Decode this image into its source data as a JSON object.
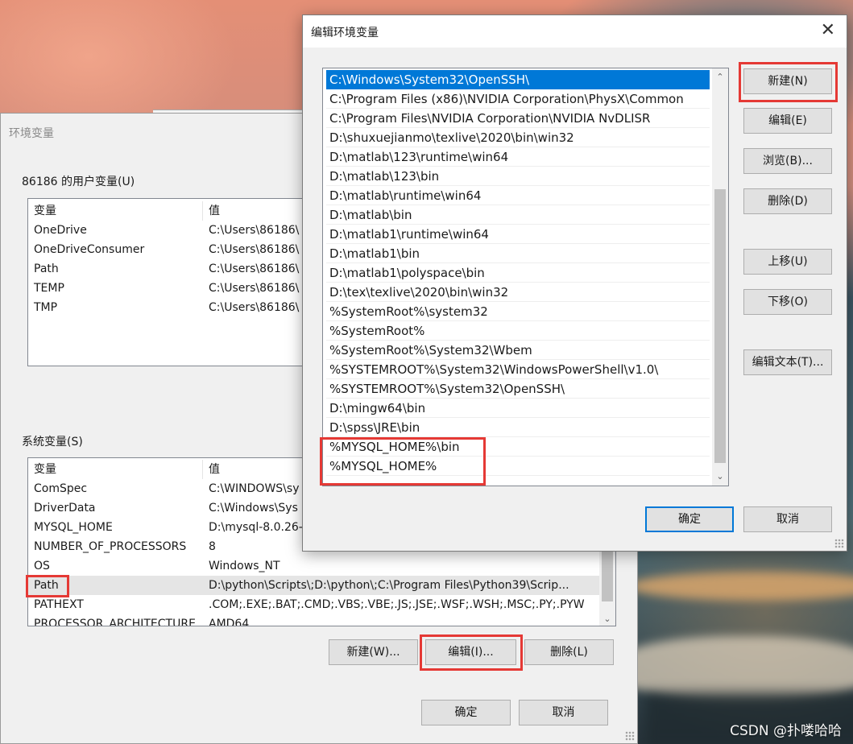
{
  "env_window": {
    "title": "环境变量",
    "user_vars": {
      "group_label": "86186 的用户变量(U)",
      "columns": [
        "变量",
        "值"
      ],
      "rows": [
        {
          "name": "OneDrive",
          "value": "C:\\Users\\86186\\"
        },
        {
          "name": "OneDriveConsumer",
          "value": "C:\\Users\\86186\\"
        },
        {
          "name": "Path",
          "value": "C:\\Users\\86186\\"
        },
        {
          "name": "TEMP",
          "value": "C:\\Users\\86186\\"
        },
        {
          "name": "TMP",
          "value": "C:\\Users\\86186\\"
        }
      ]
    },
    "system_vars": {
      "group_label": "系统变量(S)",
      "columns": [
        "变量",
        "值"
      ],
      "rows": [
        {
          "name": "ComSpec",
          "value": "C:\\WINDOWS\\sy"
        },
        {
          "name": "DriverData",
          "value": "C:\\Windows\\Sys"
        },
        {
          "name": "MYSQL_HOME",
          "value": "D:\\mysql-8.0.26-"
        },
        {
          "name": "NUMBER_OF_PROCESSORS",
          "value": "8"
        },
        {
          "name": "OS",
          "value": "Windows_NT"
        },
        {
          "name": "Path",
          "value": "D:\\python\\Scripts\\;D:\\python\\;C:\\Program Files\\Python39\\Scrip..."
        },
        {
          "name": "PATHEXT",
          "value": ".COM;.EXE;.BAT;.CMD;.VBS;.VBE;.JS;.JSE;.WSF;.WSH;.MSC;.PY;.PYW"
        },
        {
          "name": "PROCESSOR_ARCHITECTURE",
          "value": "AMD64"
        }
      ],
      "buttons": {
        "new": "新建(W)...",
        "edit": "编辑(I)...",
        "delete": "删除(L)"
      }
    },
    "buttons": {
      "ok": "确定",
      "cancel": "取消"
    }
  },
  "edit_dialog": {
    "title": "编辑环境变量",
    "entries": [
      "C:\\Windows\\System32\\OpenSSH\\",
      "C:\\Program Files (x86)\\NVIDIA Corporation\\PhysX\\Common",
      "C:\\Program Files\\NVIDIA Corporation\\NVIDIA NvDLISR",
      "D:\\shuxuejianmo\\texlive\\2020\\bin\\win32",
      "D:\\matlab\\123\\runtime\\win64",
      "D:\\matlab\\123\\bin",
      "D:\\matlab\\runtime\\win64",
      "D:\\matlab\\bin",
      "D:\\matlab1\\runtime\\win64",
      "D:\\matlab1\\bin",
      "D:\\matlab1\\polyspace\\bin",
      "D:\\tex\\texlive\\2020\\bin\\win32",
      "%SystemRoot%\\system32",
      "%SystemRoot%",
      "%SystemRoot%\\System32\\Wbem",
      "%SYSTEMROOT%\\System32\\WindowsPowerShell\\v1.0\\",
      "%SYSTEMROOT%\\System32\\OpenSSH\\",
      "D:\\mingw64\\bin",
      "D:\\spss\\JRE\\bin",
      "%MYSQL_HOME%\\bin",
      "%MYSQL_HOME%"
    ],
    "buttons": {
      "new": "新建(N)",
      "edit": "编辑(E)",
      "browse": "浏览(B)...",
      "delete": "删除(D)",
      "move_up": "上移(U)",
      "move_down": "下移(O)",
      "edit_text": "编辑文本(T)...",
      "ok": "确定",
      "cancel": "取消"
    }
  },
  "watermark": "CSDN @扑喽哈哈",
  "colors": {
    "selection": "#0078d7",
    "highlight_box": "#e53935"
  }
}
